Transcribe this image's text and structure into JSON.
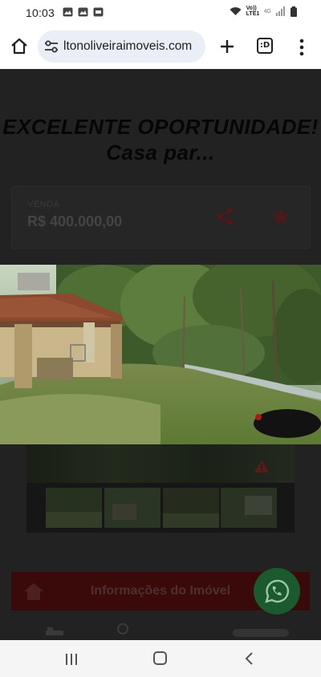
{
  "status_bar": {
    "time": "10:03",
    "network_label": "Vo)) LTE1",
    "network_type": "4G"
  },
  "browser": {
    "url": "ltonoliveiraimoveis.com",
    "tabs_label": ":D"
  },
  "listing": {
    "title": "EXCELENTE OPORTUNIDADE! Casa par...",
    "sale_label": "VENDA",
    "price": "R$ 400.000,00"
  },
  "info_bar": {
    "label": "Informações do Imóvel"
  },
  "colors": {
    "accent_red": "#8b1414",
    "whatsapp_green": "#25d366",
    "page_dim": "#222222"
  },
  "icons": [
    "home-icon",
    "tune-icon",
    "plus-icon",
    "tabs-icon",
    "menu-icon",
    "share-icon",
    "star-icon",
    "whatsapp-icon",
    "house-icon",
    "recents-icon",
    "back-icon"
  ]
}
